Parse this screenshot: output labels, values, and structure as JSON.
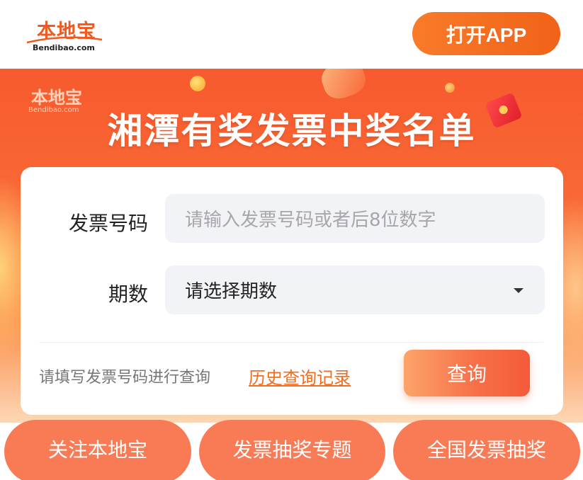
{
  "header": {
    "logo_text": "本地宝",
    "logo_sub": "Bendibao.com",
    "open_app_label": "打开APP"
  },
  "banner": {
    "logo_text": "本地宝",
    "logo_sub": "Bendibao.com",
    "title": "湘潭有奖发票中奖名单"
  },
  "form": {
    "invoice_label": "发票号码",
    "invoice_placeholder": "请输入发票号码或者后8位数字",
    "period_label": "期数",
    "period_selected": "请选择期数",
    "hint": "请填写发票号码进行查询",
    "history_link": "历史查询记录",
    "query_label": "查询"
  },
  "bottom_nav": [
    {
      "label": "关注本地宝"
    },
    {
      "label": "发票抽奖专题"
    },
    {
      "label": "全国发票抽奖"
    }
  ],
  "colors": {
    "accent": "#f06d22",
    "banner_top": "#f75a2e",
    "button": "#f97b55"
  }
}
